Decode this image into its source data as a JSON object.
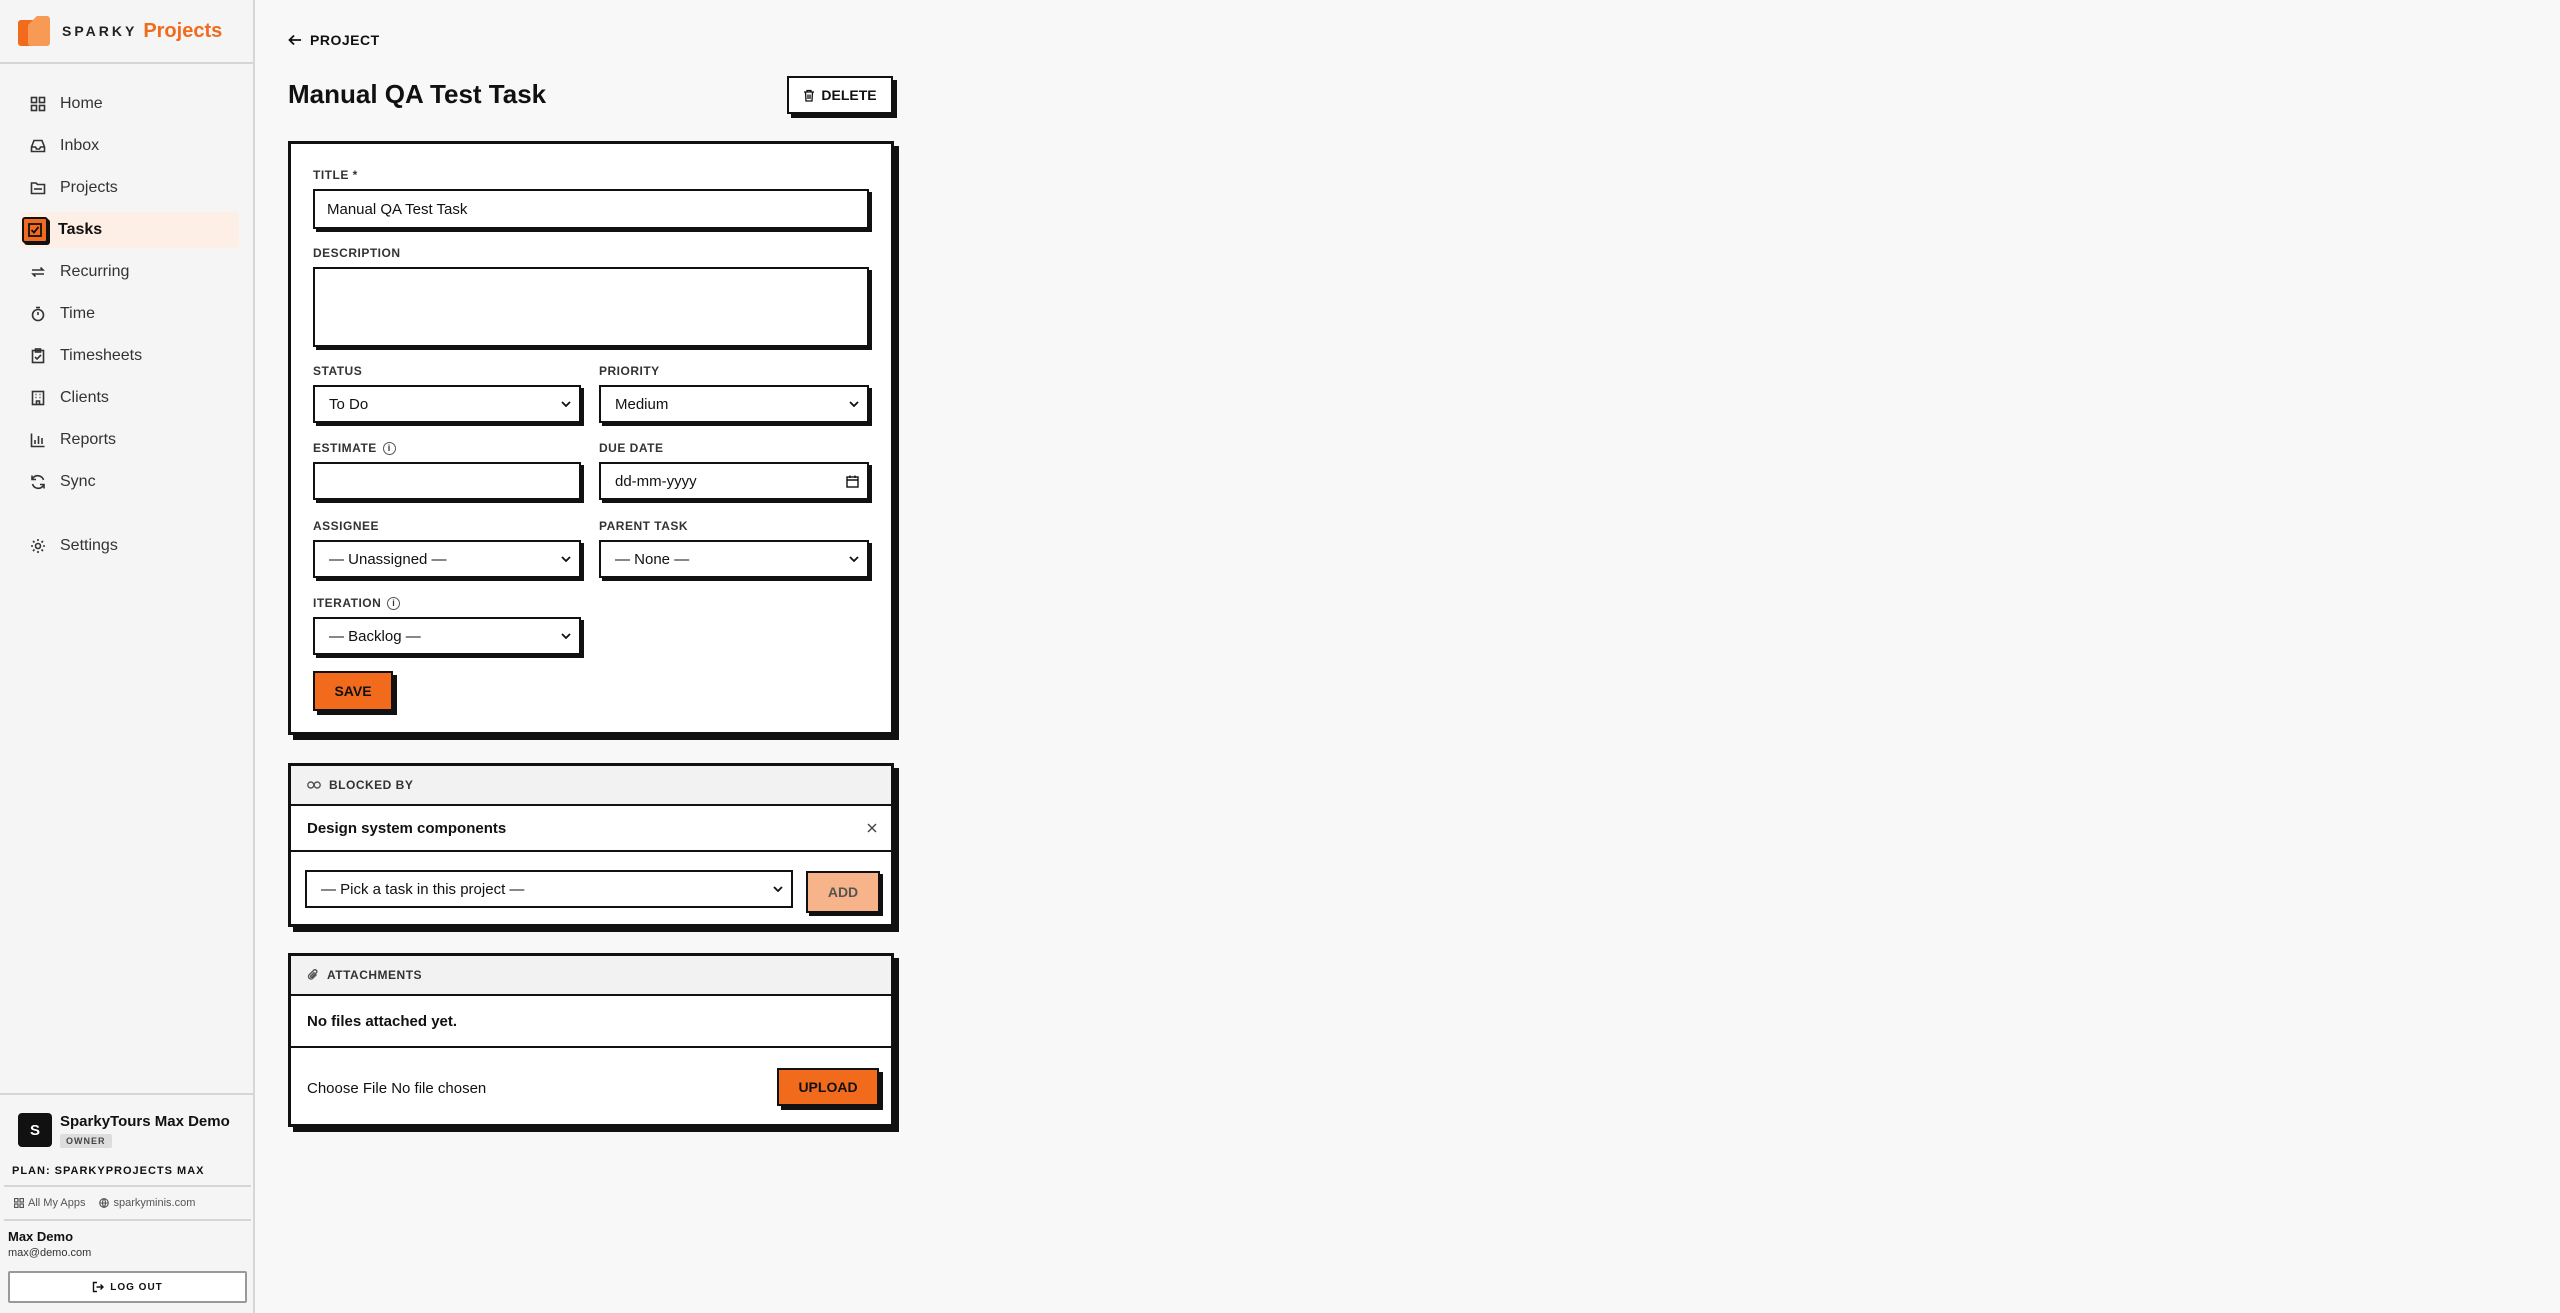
{
  "brand": {
    "sparky": "SPARKY",
    "projects": "Projects"
  },
  "nav": {
    "items": [
      {
        "label": "Home",
        "icon": "grid-icon"
      },
      {
        "label": "Inbox",
        "icon": "inbox-icon"
      },
      {
        "label": "Projects",
        "icon": "folder-icon"
      },
      {
        "label": "Tasks",
        "icon": "checkbox-icon",
        "active": true
      },
      {
        "label": "Recurring",
        "icon": "repeat-icon"
      },
      {
        "label": "Time",
        "icon": "stopwatch-icon"
      },
      {
        "label": "Timesheets",
        "icon": "clipboard-icon"
      },
      {
        "label": "Clients",
        "icon": "building-icon"
      },
      {
        "label": "Reports",
        "icon": "bar-chart-icon"
      },
      {
        "label": "Sync",
        "icon": "sync-icon"
      }
    ],
    "settings": {
      "label": "Settings",
      "icon": "gear-icon"
    }
  },
  "footer": {
    "org_initial": "S",
    "org_name": "SparkyTours Max Demo",
    "org_role": "OWNER",
    "plan": "PLAN: SPARKYPROJECTS MAX",
    "all_apps": "All My Apps",
    "site": "sparkyminis.com",
    "user_name": "Max Demo",
    "user_email": "max@demo.com",
    "logout": "LOG OUT"
  },
  "header": {
    "back_label": "PROJECT",
    "title": "Manual QA Test Task",
    "delete_label": "DELETE"
  },
  "form": {
    "title_label": "TITLE *",
    "title_value": "Manual QA Test Task",
    "description_label": "DESCRIPTION",
    "description_value": "",
    "status_label": "STATUS",
    "status_value": "To Do",
    "priority_label": "PRIORITY",
    "priority_value": "Medium",
    "estimate_label": "ESTIMATE",
    "estimate_value": "",
    "due_date_label": "DUE DATE",
    "due_date_placeholder": "dd-mm-yyyy",
    "assignee_label": "ASSIGNEE",
    "assignee_value": "— Unassigned —",
    "parent_label": "PARENT TASK",
    "parent_value": "— None —",
    "iteration_label": "ITERATION",
    "iteration_value": "— Backlog —",
    "save_label": "SAVE"
  },
  "blocked": {
    "heading": "BLOCKED BY",
    "items": [
      {
        "title": "Design system components"
      }
    ],
    "picker_value": "— Pick a task in this project —",
    "add_label": "ADD"
  },
  "attachments": {
    "heading": "ATTACHMENTS",
    "empty": "No files attached yet.",
    "file_status": "Choose File No file chosen",
    "upload_label": "UPLOAD"
  },
  "colors": {
    "accent": "#f26b1d",
    "accent_light": "#f7b38a",
    "active_bg": "#fdeee6"
  }
}
